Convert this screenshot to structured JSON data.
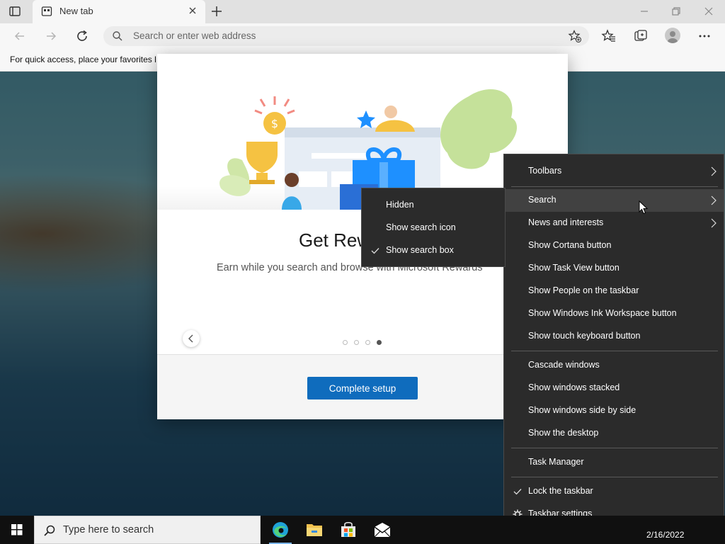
{
  "browser": {
    "tab_title": "New tab",
    "address_placeholder": "Search or enter web address",
    "favorites_bar_text": "For quick access, place your favorites here on the favorites bar."
  },
  "dialog": {
    "title": "Get Rewarded",
    "subtitle": "Earn while you search and browse with Microsoft Rewards",
    "complete_button": "Complete setup",
    "carousel_active_page": 4,
    "carousel_page_count": 4
  },
  "context_menu": {
    "items": [
      {
        "label": "Toolbars",
        "submenu": true
      },
      {
        "label": "Search",
        "submenu": true,
        "hover": true
      },
      {
        "label": "News and interests",
        "submenu": true
      },
      {
        "label": "Show Cortana button"
      },
      {
        "label": "Show Task View button"
      },
      {
        "label": "Show People on the taskbar"
      },
      {
        "label": "Show Windows Ink Workspace button"
      },
      {
        "label": "Show touch keyboard button"
      },
      {
        "label": "Cascade windows"
      },
      {
        "label": "Show windows stacked"
      },
      {
        "label": "Show windows side by side"
      },
      {
        "label": "Show the desktop"
      },
      {
        "label": "Task Manager"
      },
      {
        "label": "Lock the taskbar",
        "checked": true
      },
      {
        "label": "Taskbar settings",
        "icon": "gear-icon"
      }
    ]
  },
  "search_submenu": {
    "items": [
      {
        "label": "Hidden"
      },
      {
        "label": "Show search icon"
      },
      {
        "label": "Show search box",
        "checked": true
      }
    ]
  },
  "taskbar": {
    "search_placeholder": "Type here to search",
    "date": "2/16/2022",
    "apps": [
      "edge-icon",
      "file-explorer-icon",
      "store-icon",
      "mail-icon"
    ]
  },
  "colors": {
    "accent": "#0f6cbd",
    "menu_bg": "#2b2b2b",
    "taskbar_bg": "#101010"
  }
}
